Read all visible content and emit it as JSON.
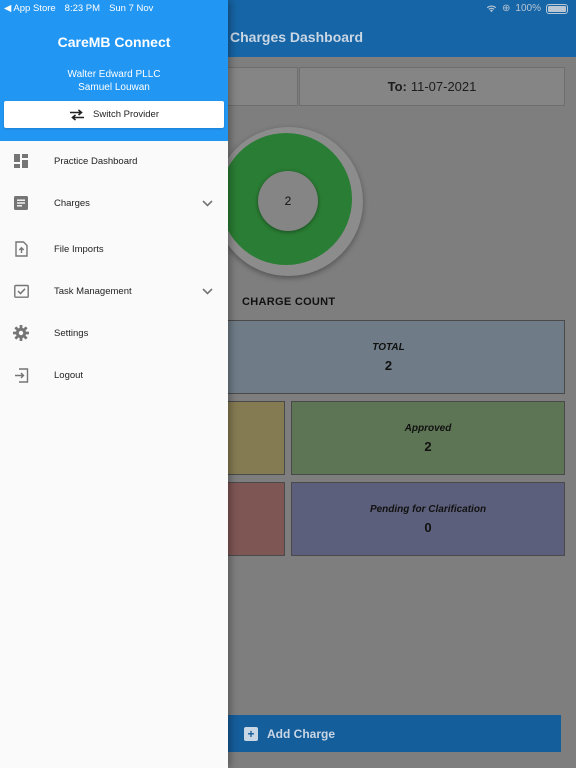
{
  "status_bar": {
    "back_app": "◀ App Store",
    "time": "8:23 PM",
    "date": "Sun 7 Nov",
    "battery": "100%"
  },
  "dashboard": {
    "title": "Charges Dashboard",
    "to_label": "To:",
    "to_date": "11-07-2021",
    "donut_value": "2",
    "charge_count_label": "CHARGE COUNT",
    "cards": {
      "total": {
        "label": "TOTAL",
        "value": "2"
      },
      "approved": {
        "label": "Approved",
        "value": "2"
      },
      "pending": {
        "label": "Pending for Clarification",
        "value": "0"
      }
    },
    "add_charge_label": "Add Charge"
  },
  "drawer": {
    "app_title": "CareMB Connect",
    "practice_name": "Walter Edward PLLC",
    "provider_name": "Samuel Louwan",
    "switch_provider_label": "Switch Provider",
    "menu": [
      {
        "label": "Practice Dashboard",
        "icon": "dashboard-icon",
        "expandable": false
      },
      {
        "label": "Charges",
        "icon": "charges-icon",
        "expandable": true
      },
      {
        "label": "File Imports",
        "icon": "file-upload-icon",
        "expandable": false
      },
      {
        "label": "Task Management",
        "icon": "task-check-icon",
        "expandable": true
      },
      {
        "label": "Settings",
        "icon": "gear-icon",
        "expandable": false
      },
      {
        "label": "Logout",
        "icon": "logout-icon",
        "expandable": false
      }
    ]
  },
  "colors": {
    "drawer_header": "#2196f3",
    "app_bar": "#1665a6",
    "icon_gray": "#757575",
    "approved_green": "#5d7554",
    "total_blue": "#6f7c87",
    "pending_indigo": "#5c5f7b"
  }
}
